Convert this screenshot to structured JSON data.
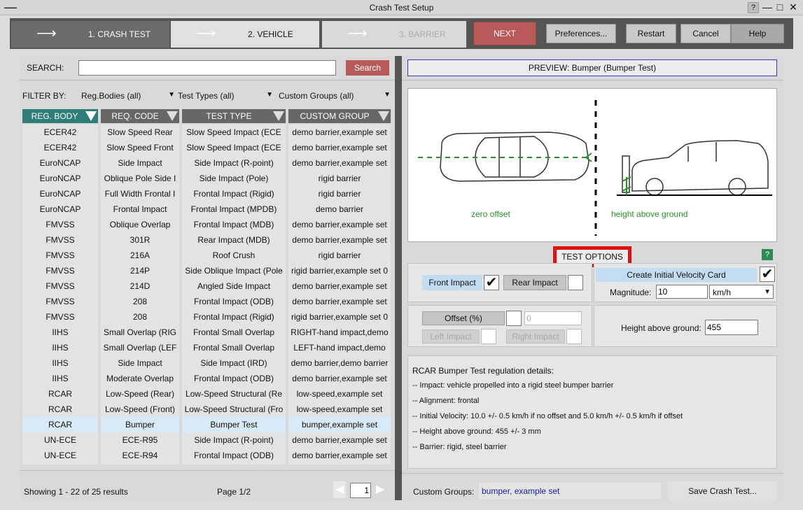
{
  "window": {
    "title": "Crash Test Setup",
    "controls": {
      "help": "?",
      "minimize": "—",
      "maximize": "□",
      "close": "✕"
    }
  },
  "wizard": {
    "steps": [
      {
        "label": "1. CRASH TEST",
        "state": "active"
      },
      {
        "label": "2. VEHICLE",
        "state": "enabled"
      },
      {
        "label": "3. BARRIER",
        "state": "disabled"
      }
    ],
    "next_label": "NEXT",
    "preferences_label": "Preferences...",
    "restart_label": "Restart",
    "cancel_label": "Cancel",
    "help_label": "Help"
  },
  "search": {
    "label": "SEARCH:",
    "value": "",
    "button": "Search"
  },
  "filter": {
    "label": "FILTER BY:",
    "reg_bodies": "Reg.Bodies (all)",
    "test_types": "Test Types (all)",
    "custom_groups": "Custom Groups (all)"
  },
  "table": {
    "headers": [
      "REG. BODY",
      "REQ. CODE",
      "TEST TYPE",
      "CUSTOM GROUP"
    ],
    "rows": [
      [
        "ECER42",
        "Slow Speed Rear",
        "Slow Speed Impact (ECE",
        "demo barrier,example set"
      ],
      [
        "ECER42",
        "Slow Speed Front",
        "Slow Speed Impact (ECE",
        "demo barrier,example set"
      ],
      [
        "EuroNCAP",
        "Side Impact",
        "Side Impact (R-point)",
        "demo barrier,example set"
      ],
      [
        "EuroNCAP",
        "Oblique Pole Side I",
        "Side Impact (Pole)",
        "rigid barrier"
      ],
      [
        "EuroNCAP",
        "Full Width Frontal I",
        "Frontal Impact (Rigid)",
        "rigid barrier"
      ],
      [
        "EuroNCAP",
        "Frontal Impact",
        "Frontal Impact (MPDB)",
        "demo barrier"
      ],
      [
        "FMVSS",
        "Oblique Overlap",
        "Frontal Impact (MDB)",
        "demo barrier,example set"
      ],
      [
        "FMVSS",
        "301R",
        "Rear Impact (MDB)",
        "demo barrier,example set"
      ],
      [
        "FMVSS",
        "216A",
        "Roof Crush",
        "rigid barrier"
      ],
      [
        "FMVSS",
        "214P",
        "Side Oblique Impact (Pole",
        "rigid barrier,example set 0"
      ],
      [
        "FMVSS",
        "214D",
        "Angled Side Impact",
        "demo barrier,example set"
      ],
      [
        "FMVSS",
        "208",
        "Frontal Impact (ODB)",
        "demo barrier,example set"
      ],
      [
        "FMVSS",
        "208",
        "Frontal Impact (Rigid)",
        "rigid barrier,example set 0"
      ],
      [
        "IIHS",
        "Small Overlap (RIG",
        "Frontal Small Overlap",
        "RIGHT-hand impact,demo"
      ],
      [
        "IIHS",
        "Small Overlap (LEF",
        "Frontal Small Overlap",
        "LEFT-hand impact,demo"
      ],
      [
        "IIHS",
        "Side Impact",
        "Side Impact (IRD)",
        "demo barrier,demo barrier"
      ],
      [
        "IIHS",
        "Moderate Overlap",
        "Frontal Impact (ODB)",
        "demo barrier,example set"
      ],
      [
        "RCAR",
        "Low-Speed (Rear)",
        "Low-Speed Structural (Re",
        "low-speed,example set"
      ],
      [
        "RCAR",
        "Low-Speed (Front)",
        "Low-Speed Structural (Fro",
        "low-speed,example set"
      ],
      [
        "RCAR",
        "Bumper",
        "Bumper Test",
        "bumper,example set"
      ],
      [
        "UN-ECE",
        "ECE-R95",
        "Side Impact (R-point)",
        "demo barrier,example set"
      ],
      [
        "UN-ECE",
        "ECE-R94",
        "Frontal Impact (ODB)",
        "demo barrier,example set"
      ]
    ],
    "selected_row": 19
  },
  "footer": {
    "showing": "Showing 1 - 22 of 25 results",
    "page": "Page 1/2",
    "page_input": "1"
  },
  "preview": {
    "title": "PREVIEW: Bumper (Bumper Test)",
    "label_left": "zero offset",
    "label_right": "height above ground"
  },
  "options": {
    "title": "TEST OPTIONS",
    "help": "?",
    "front_impact": {
      "label": "Front Impact",
      "checked": true
    },
    "rear_impact": {
      "label": "Rear Impact",
      "checked": false
    },
    "initial_velocity": {
      "label": "Create Initial Velocity Card",
      "checked": true
    },
    "magnitude": {
      "label": "Magnitude:",
      "value": "10",
      "unit": "km/h"
    },
    "offset": {
      "label": "Offset (%)",
      "value": "0"
    },
    "left_impact": "Left Impact",
    "right_impact": "Right Impact",
    "height": {
      "label": "Height above ground:",
      "value": "455"
    }
  },
  "details": {
    "title": "RCAR Bumper Test regulation details:",
    "lines": [
      "-- Impact: vehicle propelled into a rigid steel bumper barrier",
      "-- Alignment: frontal",
      "-- Initial Velocity: 10.0 +/- 0.5 km/h if no offset and 5.0 km/h +/- 0.5 km/h if offset",
      "-- Height above ground: 455 +/- 3 mm",
      "-- Barrier: rigid, steel barrier"
    ]
  },
  "custom_groups": {
    "label": "Custom Groups:",
    "value": "bumper, example set"
  },
  "save_label": "Save Crash Test...",
  "colors": {
    "wizard_bg": "#555555",
    "active_step": "#6b6b6b",
    "next": "#b95a5a",
    "header": "#676767",
    "reg_header": "#2e7d78",
    "selected_row": "#d8eaf7",
    "highlight_red": "#e01010",
    "velocity_bg": "#c4dcf2"
  }
}
